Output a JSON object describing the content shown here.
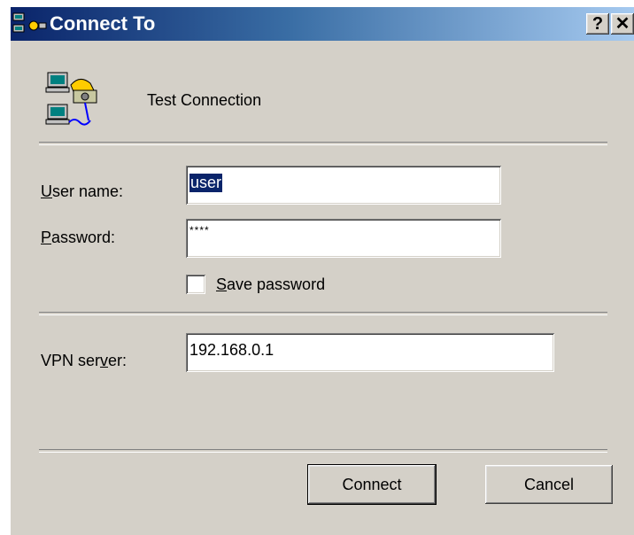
{
  "window": {
    "title": "Connect To",
    "help_label": "?",
    "close_label": "✕"
  },
  "connection": {
    "name": "Test Connection",
    "icon": "dialup-computers-phone-icon"
  },
  "form": {
    "username_label": "User name:",
    "username_value": "user",
    "password_label": "Password:",
    "password_value": "****",
    "save_password_label": "Save password",
    "save_password_checked": false,
    "vpn_label": "VPN server:",
    "vpn_value": "192.168.0.1"
  },
  "buttons": {
    "connect": "Connect",
    "cancel": "Cancel"
  },
  "colors": {
    "title_start": "#0a246a",
    "title_end": "#a6caf0",
    "face": "#d4d0c8"
  }
}
